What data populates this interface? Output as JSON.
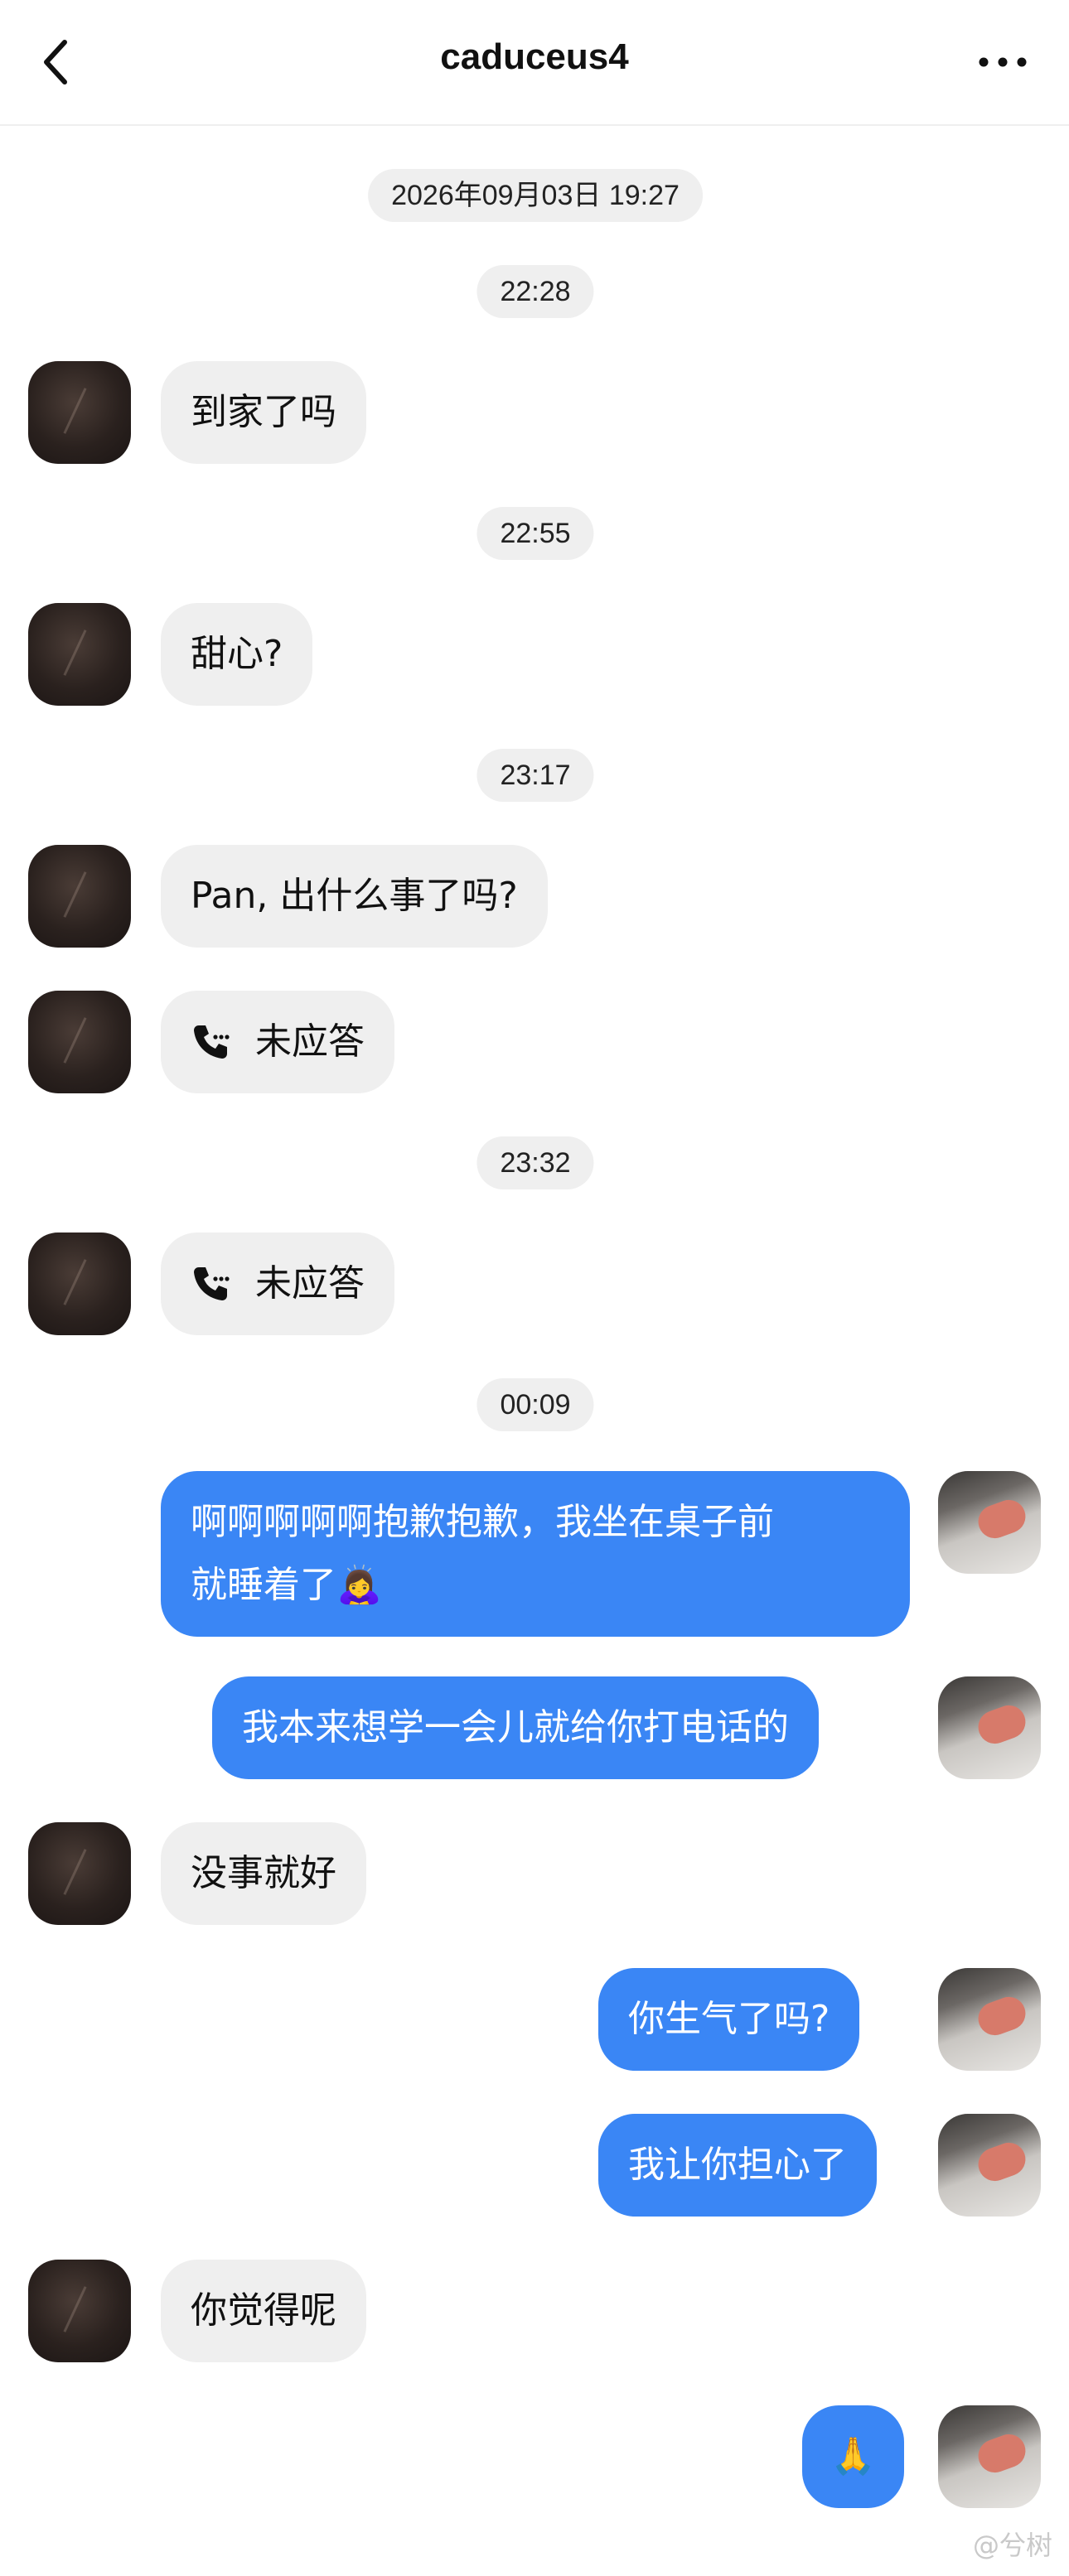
{
  "header": {
    "title": "caduceus4"
  },
  "timestamps": [
    "2026年09月03日 19:27",
    "22:28",
    "22:55",
    "23:17",
    "23:32",
    "00:09"
  ],
  "messages": {
    "m1": "到家了吗",
    "m2": "甜心?",
    "m3": "Pan, 出什么事了吗?",
    "m4": "未应答",
    "m5": "未应答",
    "m6_line1": "啊啊啊啊啊抱歉抱歉，我坐在桌子前",
    "m6_line2": "就睡着了🙇‍♀️",
    "m7": "我本来想学一会儿就给你打电话的",
    "m8": "没事就好",
    "m9": "你生气了吗?",
    "m10": "我让你担心了",
    "m11": "你觉得呢",
    "m12": "🙏"
  },
  "watermark": "@兮树",
  "colors": {
    "outgoing": "#3a86f5",
    "incoming": "#efefef"
  }
}
